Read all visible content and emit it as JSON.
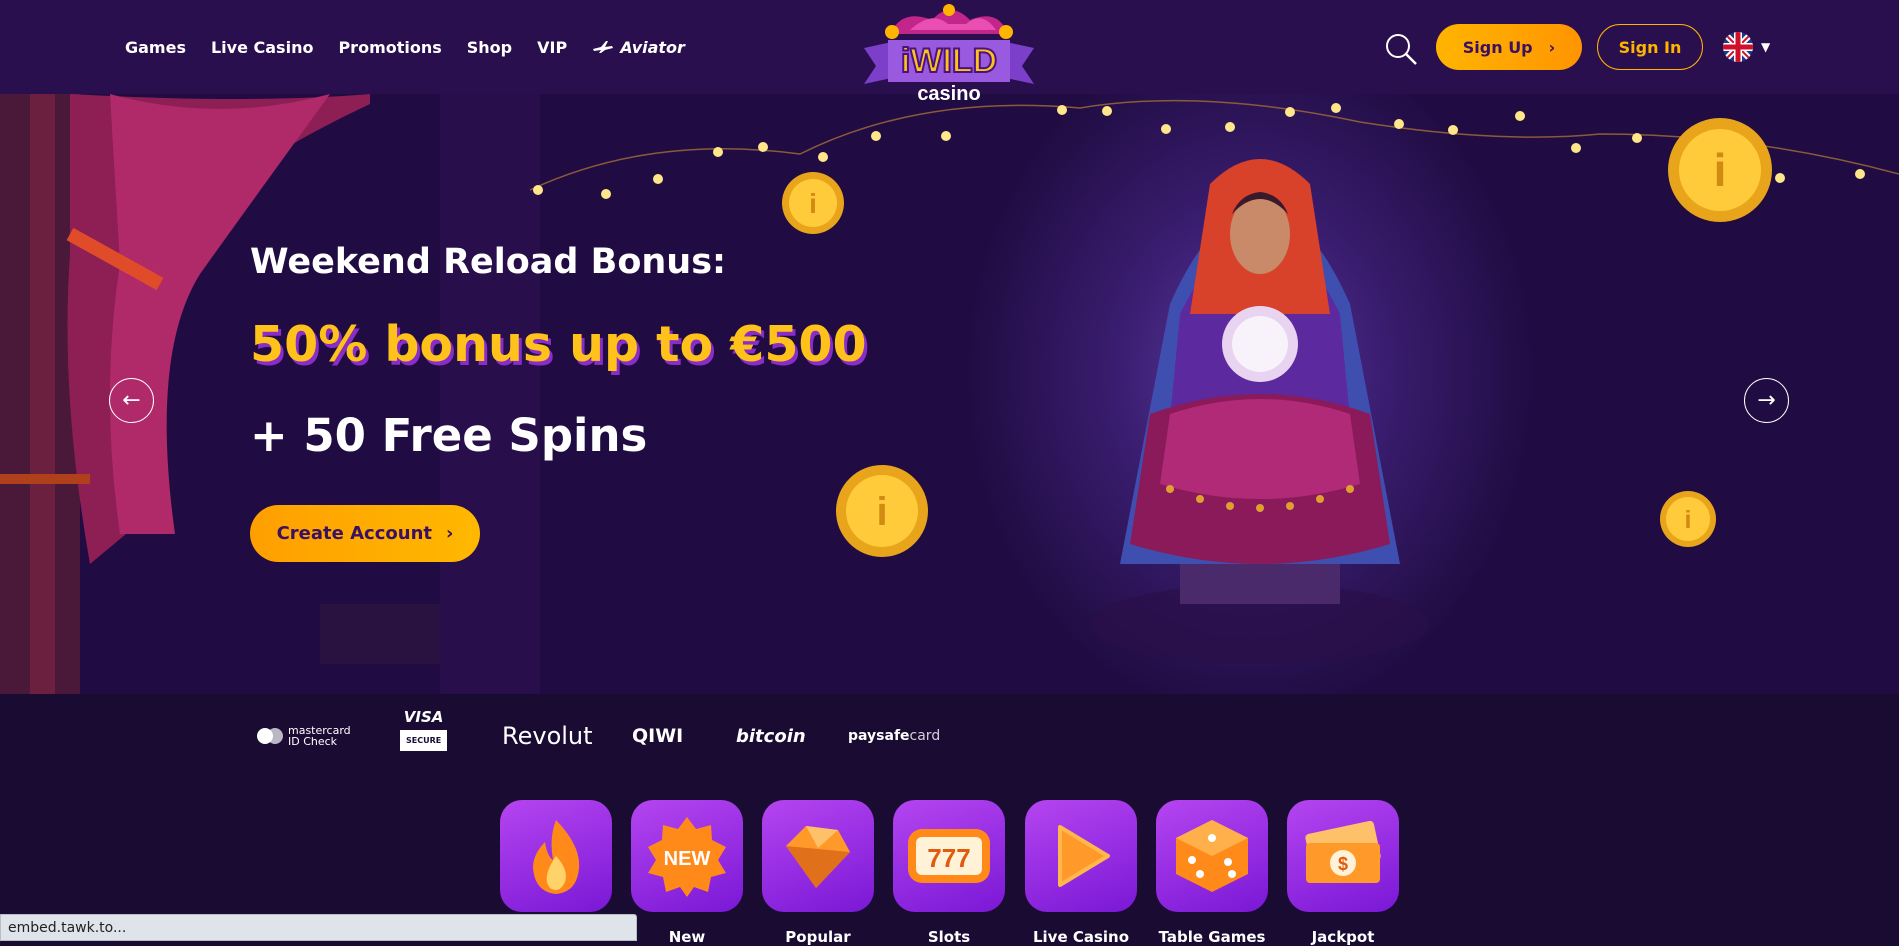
{
  "nav": {
    "games": "Games",
    "live_casino": "Live Casino",
    "promotions": "Promotions",
    "shop": "Shop",
    "vip": "VIP",
    "aviator": "Aviator"
  },
  "logo": {
    "top": "iWILD",
    "bottom": "casino"
  },
  "header": {
    "sign_up": "Sign Up",
    "sign_in": "Sign In",
    "language_icon": "uk-flag-icon"
  },
  "hero": {
    "title": "Weekend Reload Bonus:",
    "bonus": "50% bonus up to €500",
    "spins": "+ 50 Free Spins",
    "cta": "Create Account"
  },
  "payments": {
    "mastercard_1": "mastercard",
    "mastercard_2": "ID Check",
    "visa_1": "VISA",
    "visa_2": "SECURE",
    "revolut": "Revolut",
    "qiwi": "QIWI",
    "bitcoin": "bitcoin",
    "paysafe_bold": "paysafe",
    "paysafe_light": "card"
  },
  "categories": [
    {
      "label": "",
      "icon": "fire-icon"
    },
    {
      "label": "New",
      "icon": "new-badge-icon"
    },
    {
      "label": "Popular",
      "icon": "diamond-icon"
    },
    {
      "label": "Slots",
      "icon": "777-slot-icon"
    },
    {
      "label": "Live Casino",
      "icon": "play-icon"
    },
    {
      "label": "Table Games",
      "icon": "dice-icon"
    },
    {
      "label": "Jackpot",
      "icon": "money-icon"
    }
  ],
  "status_bar": "embed.tawk.to...",
  "colors": {
    "accent": "#ffb400",
    "bg": "#1a0b33",
    "header": "#2a0f4e",
    "tile": "#9b30e6"
  }
}
